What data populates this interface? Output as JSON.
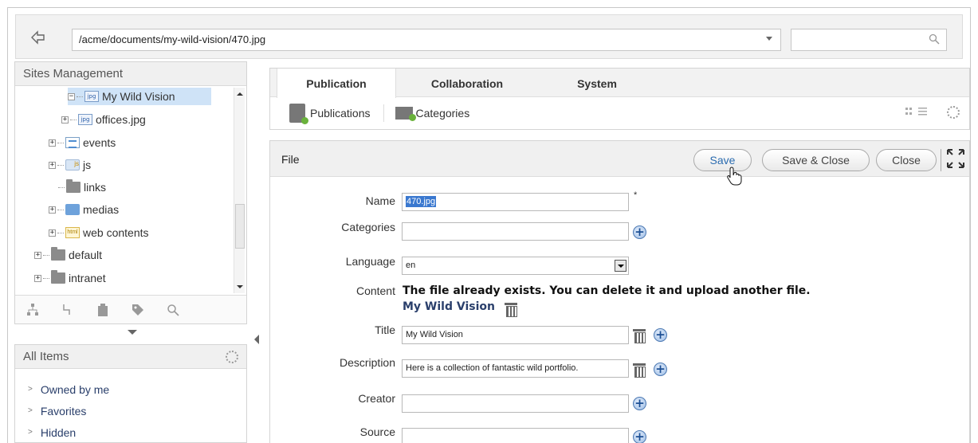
{
  "address_bar": {
    "path": "/acme/documents/my-wild-vision/470.jpg",
    "search_value": ""
  },
  "sites": {
    "title": "Sites Management",
    "tree": [
      {
        "label": "My Wild Vision",
        "icon": "jpg-folder-icon",
        "selected": true
      },
      {
        "label": "offices.jpg",
        "icon": "jpg-file-icon"
      },
      {
        "label": "events",
        "icon": "list-icon"
      },
      {
        "label": "js",
        "icon": "js-folder-icon"
      },
      {
        "label": "links",
        "icon": "link-folder-icon"
      },
      {
        "label": "medias",
        "icon": "media-folder-icon"
      },
      {
        "label": "web contents",
        "icon": "html-folder-icon"
      },
      {
        "label": "default",
        "icon": "folder-icon"
      },
      {
        "label": "intranet",
        "icon": "folder-icon"
      }
    ],
    "tools": [
      "site-tree-icon",
      "connector-icon",
      "clipboard-icon",
      "tag-icon",
      "search-icon"
    ]
  },
  "all_items": {
    "title": "All Items",
    "items": [
      "Owned by me",
      "Favorites",
      "Hidden"
    ]
  },
  "tabs": {
    "items": [
      "Publication",
      "Collaboration",
      "System"
    ],
    "active": "Publication",
    "sub_items": [
      "Publications",
      "Categories"
    ]
  },
  "form": {
    "title": "File",
    "buttons": {
      "save": "Save",
      "save_close": "Save & Close",
      "close": "Close"
    },
    "labels": {
      "name": "Name",
      "categories": "Categories",
      "language": "Language",
      "content": "Content",
      "title": "Title",
      "description": "Description",
      "creator": "Creator",
      "source": "Source"
    },
    "values": {
      "name": "470.jpg",
      "categories": "",
      "language": "en",
      "title": "My Wild Vision",
      "description": "Here is a collection of fantastic wild portfolio.",
      "creator": "",
      "source": ""
    },
    "required_mark": "*",
    "content_message": "The file already exists. You can delete it and upload another file.",
    "content_file": "My Wild Vision"
  },
  "colors": {
    "accent": "#2b6cb0",
    "selection": "#cfe3f7",
    "link": "#2a3f6b"
  }
}
